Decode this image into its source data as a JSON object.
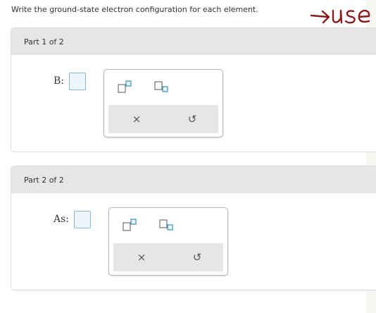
{
  "prompt": "Write the ground-state electron configuration for each element.",
  "annotation": "→use",
  "parts": [
    {
      "header": "Part 1 of 2",
      "element_label": "B:",
      "answer_value": ""
    },
    {
      "header": "Part 2 of 2",
      "element_label": "As:",
      "answer_value": ""
    }
  ],
  "toolbar": {
    "superscript_icon": "superscript-template-icon",
    "subscript_icon": "subscript-template-icon",
    "clear_symbol": "×",
    "undo_symbol": "↺"
  },
  "colors": {
    "header_bg": "#e4e6e7",
    "answer_border": "#88b7d2",
    "template_accent": "#3a8fc4",
    "annotation_ink": "#8b1a1a"
  }
}
